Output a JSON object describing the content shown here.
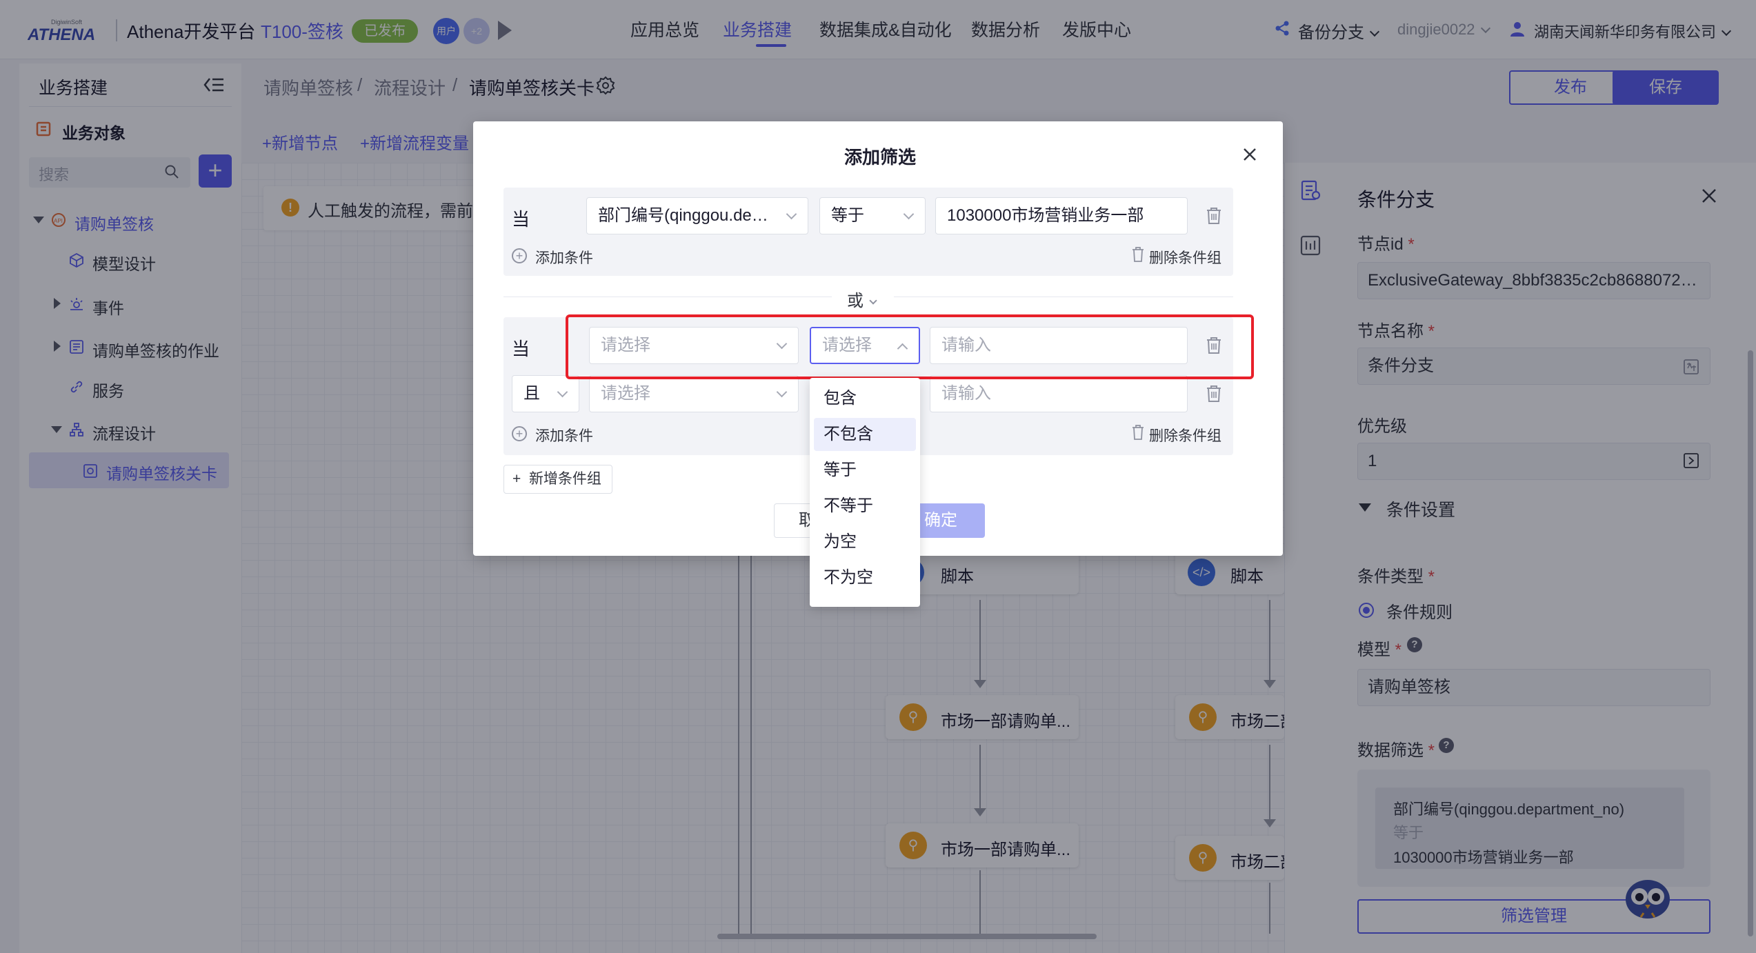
{
  "topbar": {
    "logo_text": "ATHENA",
    "logo_subtext": "DigiwinSoft",
    "platform_title": "Athena开发平台",
    "app_name": "T100-签核",
    "status": "已发布",
    "avatar_a": "用户",
    "avatar_b": "+2",
    "nav": [
      "应用总览",
      "业务搭建",
      "数据集成&自动化",
      "数据分析",
      "发版中心"
    ],
    "nav_active_index": 1,
    "branch": "备份分支",
    "user": "dingjie0022",
    "company": "湖南天闻新华印务有限公司"
  },
  "sidebar": {
    "title": "业务搭建",
    "section": "业务对象",
    "search_placeholder": "搜索",
    "tree": {
      "root": "请购单签核",
      "model": "模型设计",
      "event": "事件",
      "jobs": "请购单签核的作业",
      "service": "服务",
      "flow": "流程设计",
      "flow_child": "请购单签核关卡"
    }
  },
  "main": {
    "breadcrumb": [
      "请购单签核",
      "流程设计",
      "请购单签核关卡"
    ],
    "publish_label": "发布",
    "save_label": "保存",
    "toolbar": [
      "+新增节点",
      "+新增流程变量"
    ],
    "notice": "人工触发的流程，需前",
    "nodes": {
      "script_a": "脚本",
      "script_b": "脚本",
      "market1_a": "市场一部请购单...",
      "market1_b": "市场一部请购单...",
      "market2_a": "市场二部",
      "market2_b": "市场二部"
    }
  },
  "rpanel": {
    "title": "条件分支",
    "node_id_label": "节点id",
    "node_id_value": "ExclusiveGateway_8bbf3835c2cb8688072d...",
    "node_name_label": "节点名称",
    "node_name_value": "条件分支",
    "priority_label": "优先级",
    "priority_value": "1",
    "cond_settings": "条件设置",
    "cond_type_label": "条件类型",
    "cond_type_value": "条件规则",
    "model_label": "模型",
    "model_value": "请购单签核",
    "filter_label": "数据筛选",
    "filter_field": "部门编号(qinggou.department_no)",
    "filter_op": "等于",
    "filter_value": "1030000市场营销业务一部",
    "filter_btn": "筛选管理"
  },
  "modal": {
    "title": "添加筛选",
    "group1": {
      "when": "当",
      "field": "部门编号(qinggou.depa...",
      "op": "等于",
      "value": "1030000市场营销业务一部",
      "add_condition": "添加条件",
      "delete_group": "删除条件组"
    },
    "or_label": "或",
    "group2": {
      "when": "当",
      "and_label": "且",
      "field_placeholder": "请选择",
      "op_placeholder": "请选择",
      "value_placeholder": "请输入",
      "add_condition": "添加条件",
      "delete_group": "删除条件组"
    },
    "new_group": "新增条件组",
    "cancel_label": "取消",
    "ok_label": "确定"
  },
  "dropdown": {
    "options": [
      "包含",
      "不包含",
      "等于",
      "不等于",
      "为空",
      "不为空"
    ],
    "hover_index": 1
  },
  "colors": {
    "accent": "#5b5ef0",
    "published": "#8bc34a",
    "highlight": "#e8202a",
    "warning": "#f4a623"
  }
}
